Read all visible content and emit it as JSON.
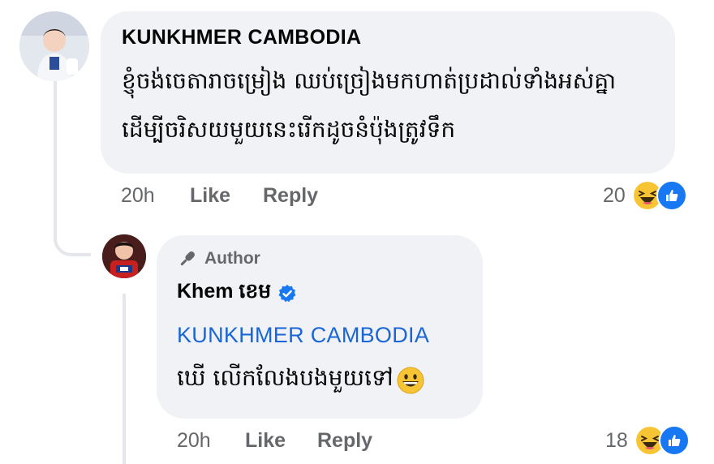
{
  "comment": {
    "author": "KUNKHMER CAMBODIA",
    "text": "ខ្ញុំចង់ចេតារាចម្រៀង ឈប់ច្រៀងមកហាត់ប្រដាល់ទាំងអស់គ្នាដើម្បីចរិសយមួយនេះរើកដូចនំប៉ុងត្រូវទឹក",
    "time": "20h",
    "like_label": "Like",
    "reply_label": "Reply",
    "reaction_count": "20",
    "reaction_icons": [
      "haha-icon",
      "like-icon"
    ]
  },
  "reply": {
    "author_badge": "Author",
    "author_badge_icon": "microphone-icon",
    "author_name": "Khem ខេម",
    "verified_icon": "verified-badge-icon",
    "mention": "KUNKHMER CAMBODIA",
    "text": "ឃើ លើកលែងបងមួយទៅ",
    "text_emoji": "grinning-face-icon",
    "time": "20h",
    "like_label": "Like",
    "reply_label": "Reply",
    "reaction_count": "18",
    "reaction_icons": [
      "haha-icon",
      "like-icon"
    ]
  },
  "colors": {
    "bubble": "#f0f2f5",
    "meta_text": "#65676b",
    "link": "#1b66d6",
    "like_blue": "#1877f2",
    "haha_yellow": "#f7c434"
  }
}
